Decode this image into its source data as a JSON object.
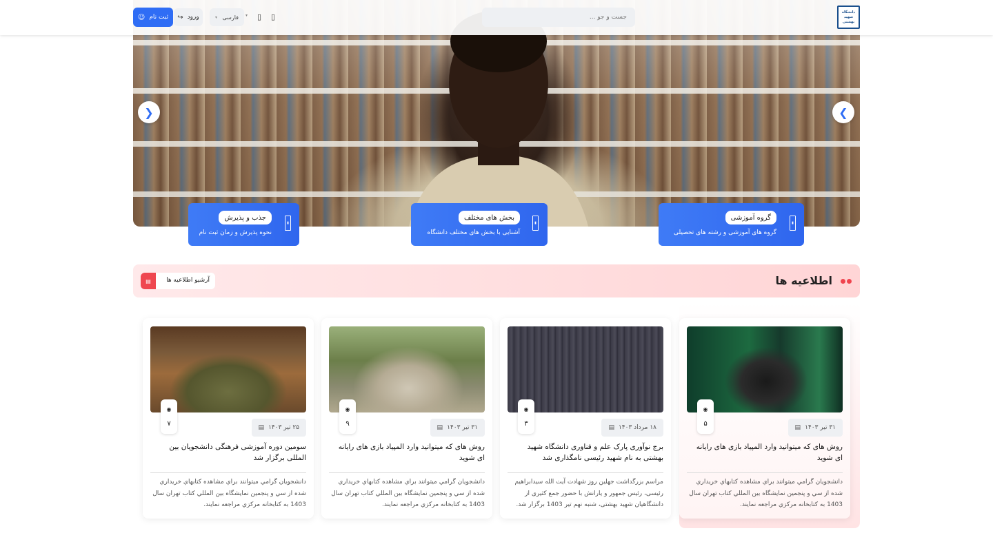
{
  "header": {
    "logo_text": "دانشگاه شهید بهشتی",
    "search_placeholder": "جست و جو ...",
    "language": "فارسی",
    "login_label": "ورود",
    "register_label": "ثبت نام"
  },
  "hero": {
    "features": [
      {
        "title": "گروه آموزشی",
        "subtitle": "گروه های آموزشی و رشته های تحصیلی"
      },
      {
        "title": "بخش های مختلف",
        "subtitle": "آشنایی با بخش های مختلف دانشگاه"
      },
      {
        "title": "جذب و پذیرش",
        "subtitle": "نحوه پذیرش و زمان ثبت نام"
      }
    ]
  },
  "notices": {
    "heading": "اطلاعیه ها",
    "archive_label": "آرشیو اطلاعیه ها",
    "cards": [
      {
        "date": "۳۱ تیر ۱۴۰۳",
        "views": "۵",
        "title": "روش های که میتوانید وارد المپیاد بازی های رایانه ای شوید",
        "description": "دانشجويان گرامي ميتوانند براي مشاهده کتابهاي خريداري شده از سي و پنجمين نمايشگاه بين المللي کتاب تهران سال 1403 به کتابخانه مرکزي مراجعه نمايند."
      },
      {
        "date": "۱۸ مرداد ۱۴۰۳",
        "views": "۳",
        "title": "برج نوآوری پارک علم و فناوری دانشگاه شهید بهشتی به نام شهید رئیسی نامگذاری شد",
        "description": "مراسم بزرگداشت جهلین روز شهادت آیت الله سیدابراهیم رئیسی، رئیس جمهور و یارانش با حضور جمع کثیری از دانشگاهیان شهید بهشتی، شنبه نهم تیر 1403 برگزار شد."
      },
      {
        "date": "۳۱ تیر ۱۴۰۳",
        "views": "۹",
        "title": "روش های که میتوانید وارد المپیاد بازی های رایانه ای شوید",
        "description": "دانشجويان گرامي ميتوانند براي مشاهده کتابهاي خريداري شده از سي و پنجمين نمايشگاه بين المللي کتاب تهران سال 1403 به کتابخانه مرکزي مراجعه نمايند."
      },
      {
        "date": "۲۵ تیر ۱۴۰۳",
        "views": "۷",
        "title": "سومین دوره آموزشی فرهنگی دانشجویان بین المللی برگزار شد",
        "description": "دانشجويان گرامي ميتوانند براي مشاهده کتابهاي خريداري شده از سي و پنجمين نمايشگاه بين المللي کتاب تهران سال 1403 به کتابخانه مرکزي مراجعه نمايند."
      }
    ]
  },
  "colors": {
    "primary": "#2f6df5",
    "accent_red": "#ef4750",
    "notice_bg": "#ffe2e3"
  }
}
